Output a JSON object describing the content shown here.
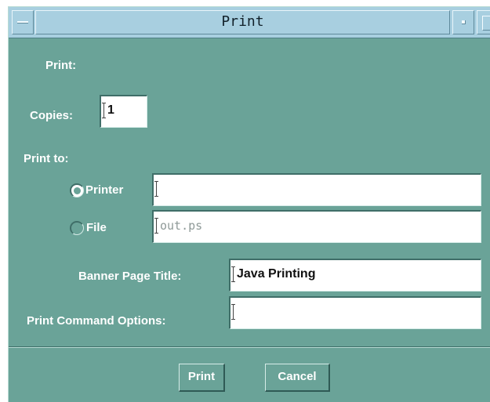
{
  "window": {
    "title": "Print"
  },
  "titlebar": {
    "menu_icon": "window-menu-icon",
    "minimize_icon": "minimize-icon",
    "maximize_icon": "maximize-icon"
  },
  "form": {
    "print_heading": "Print:",
    "copies_label": "Copies:",
    "copies_value": "1",
    "print_to_label": "Print to:",
    "printer_option": {
      "label": "Printer",
      "selected": true,
      "value": ""
    },
    "file_option": {
      "label": "File",
      "selected": false,
      "value": "out.ps"
    },
    "banner_label": "Banner Page Title:",
    "banner_value": "Java Printing",
    "options_label": "Print Command Options:",
    "options_value": ""
  },
  "buttons": {
    "print": "Print",
    "cancel": "Cancel"
  },
  "colors": {
    "dialog_bg": "#6aa398",
    "titlebar_bg": "#a8cfe0"
  }
}
